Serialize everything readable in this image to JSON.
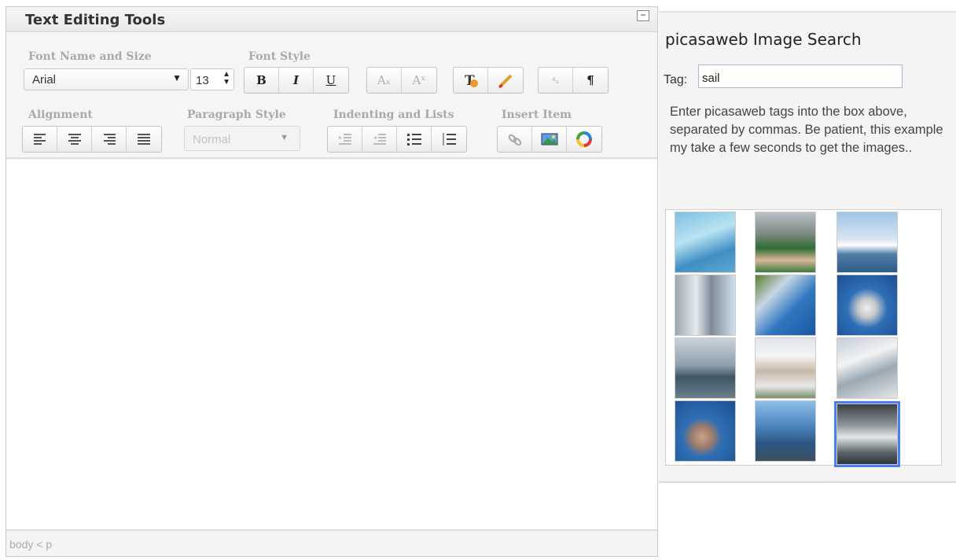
{
  "editor": {
    "title": "Text Editing Tools",
    "collapse_glyph": "−",
    "groups": {
      "font": "Font Name and Size",
      "style": "Font Style",
      "align": "Alignment",
      "para": "Paragraph Style",
      "indent": "Indenting and Lists",
      "insert": "Insert Item"
    },
    "font_name": "Arial",
    "font_size": "13",
    "style_buttons": [
      "B",
      "I",
      "U"
    ],
    "script_buttons": [
      "Aₓ",
      "Aˣ"
    ],
    "case_button": "⁴ₐ",
    "pilcrow": "¶",
    "paragraph_style": "Normal",
    "status_path": "body < p",
    "icons": {
      "bold": "bold-icon",
      "italic": "italic-icon",
      "underline": "underline-icon",
      "subscript": "subscript-icon",
      "superscript": "superscript-icon",
      "text_color": "text-color-icon",
      "highlight": "highlight-icon",
      "remove_format": "remove-format-icon",
      "pilcrow": "pilcrow-icon",
      "align_left": "align-left-icon",
      "align_center": "align-center-icon",
      "align_right": "align-right-icon",
      "align_justify": "align-justify-icon",
      "outdent": "outdent-icon",
      "indent": "indent-icon",
      "bullet_list": "bullet-list-icon",
      "numbered_list": "numbered-list-icon",
      "link": "link-icon",
      "image": "image-icon",
      "color_wheel": "color-wheel-icon"
    }
  },
  "search": {
    "title": "picasaweb Image Search",
    "tag_label": "Tag:",
    "tag_value": "sail",
    "help_text": "Enter picasaweb tags into the box above, separated by commas. Be patient, this example my take a few seconds to get the images..",
    "thumbnail_count": 12,
    "selected_index": 11
  }
}
